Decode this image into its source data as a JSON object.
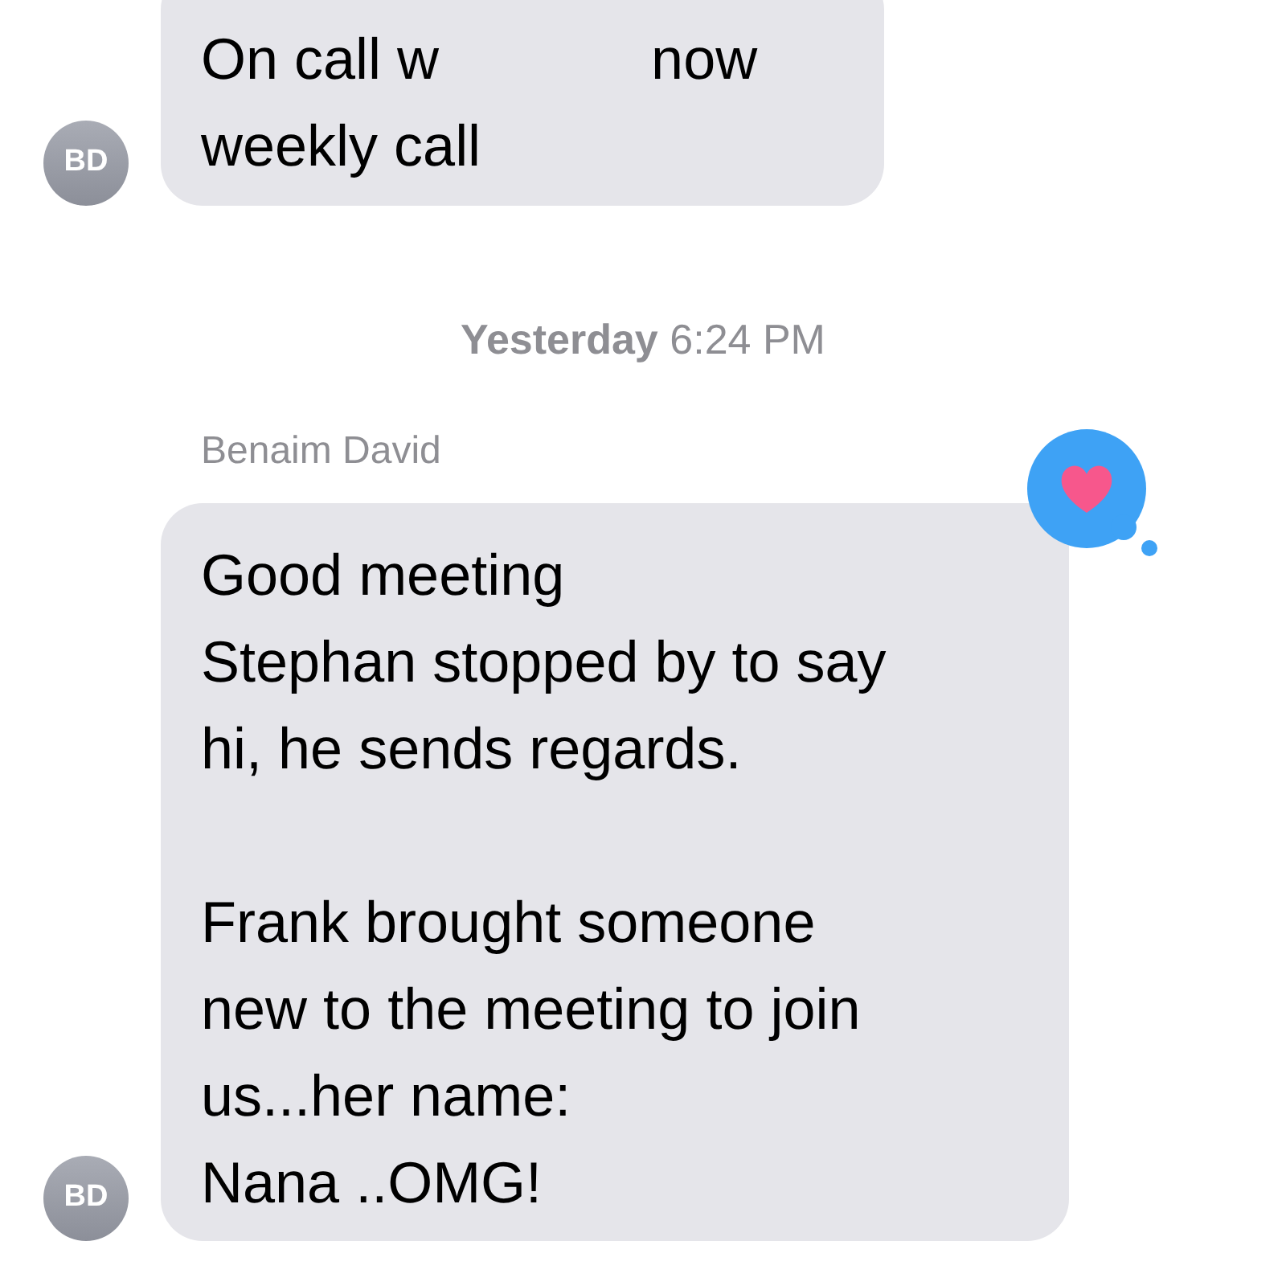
{
  "messages": [
    {
      "avatar": "BD",
      "lines": [
        [
          "On call w",
          "now"
        ],
        [
          "weekly call"
        ]
      ]
    },
    {
      "timestamp": "**Yesterday** 6:24 PM",
      "sender": "Benaim David",
      "hearted": true,
      "avatar": "BD",
      "text": "Good meeting\nStephan stopped by to say\nhi, he sends regards.\n\nFrank brought someone\nnew to the meeting to join\nus...her name:\nNana ..OMG!"
    }
  ]
}
